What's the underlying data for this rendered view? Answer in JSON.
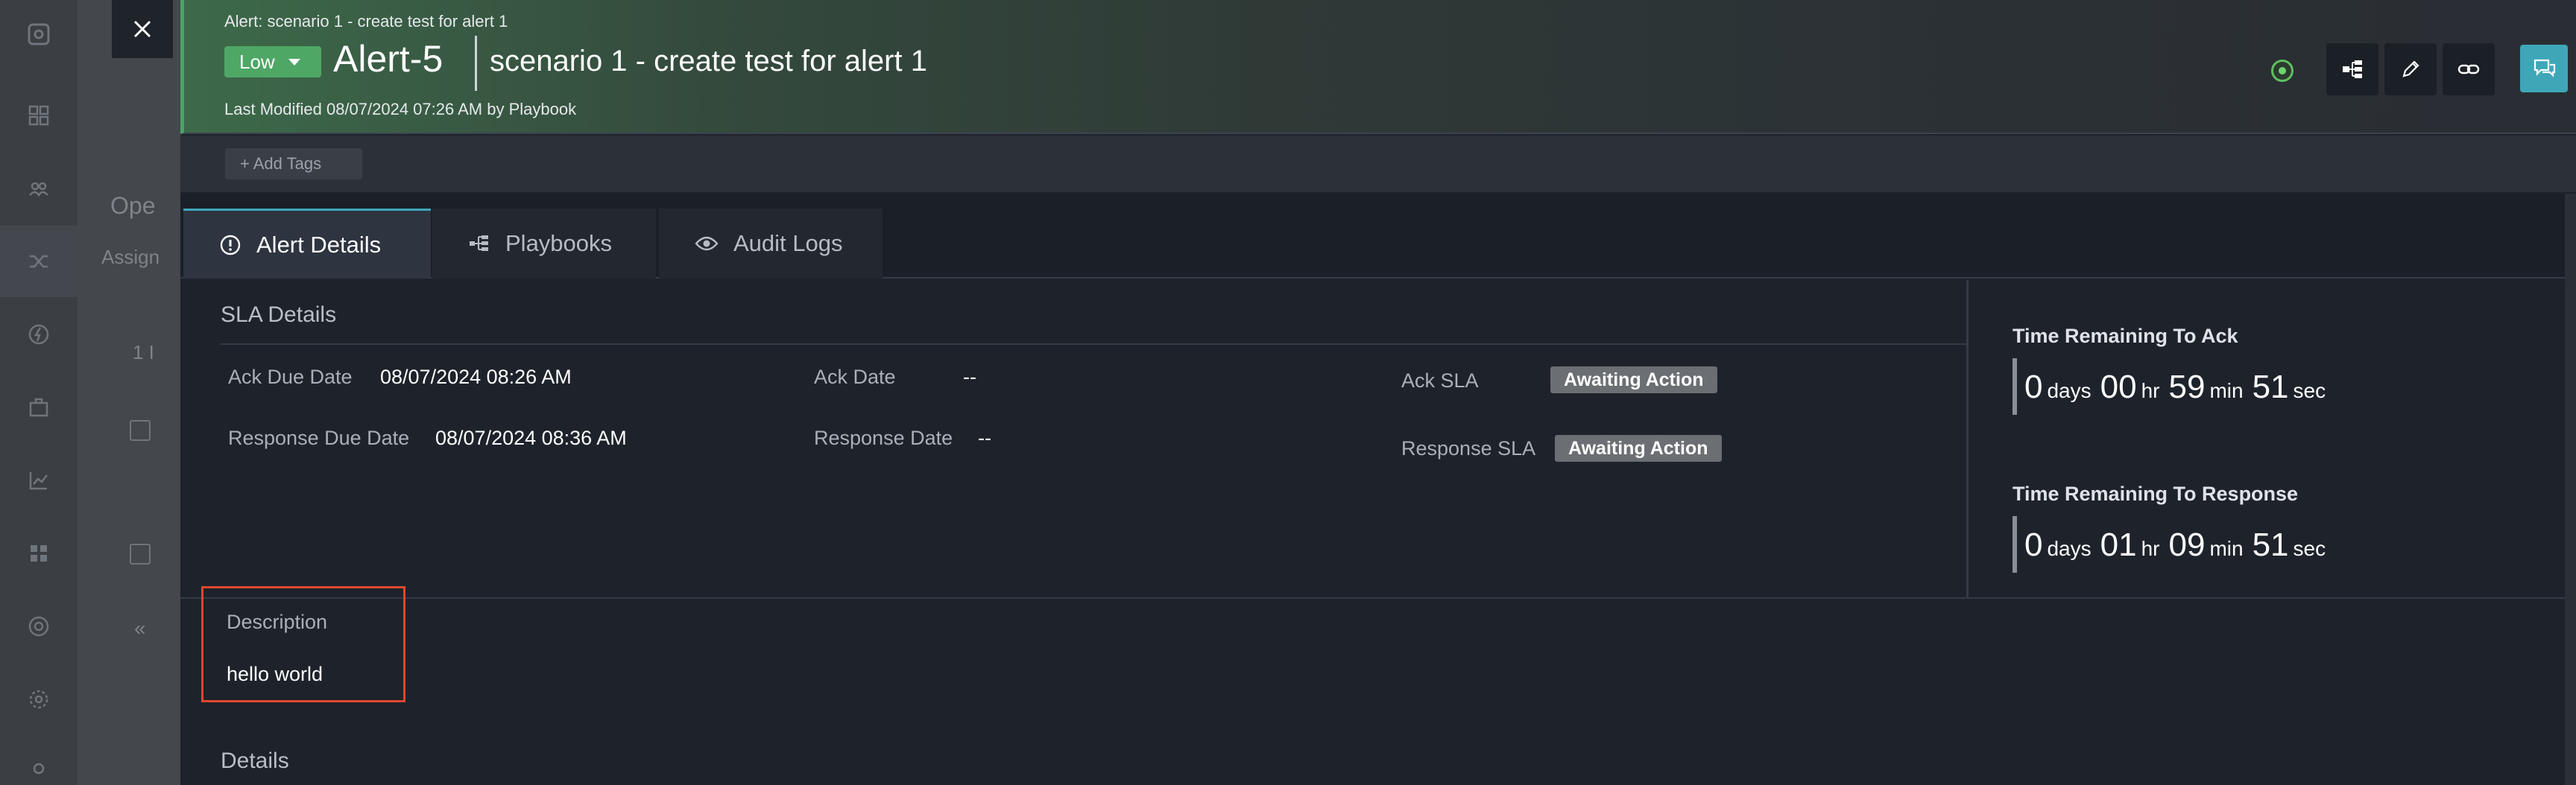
{
  "background": {
    "partial_heading": "Ope",
    "partial_subheading": "Assign",
    "partial_count": "1 I",
    "collapse_glyph": "«"
  },
  "header": {
    "breadcrumb": "Alert: scenario 1 - create test for alert 1",
    "severity": "Low",
    "alert_id": "Alert-5",
    "alert_title": "scenario 1 - create test for alert 1",
    "last_modified": "Last Modified 08/07/2024 07:26 AM by Playbook",
    "status_color": "#5fbf5f",
    "accent_color": "#3fa6b8"
  },
  "tags": {
    "add_label": "+ Add Tags"
  },
  "tabs": [
    {
      "label": "Alert Details",
      "icon": "info-circle-icon",
      "active": true
    },
    {
      "label": "Playbooks",
      "icon": "playbook-icon",
      "active": false
    },
    {
      "label": "Audit Logs",
      "icon": "eye-icon",
      "active": false
    }
  ],
  "sla": {
    "heading": "SLA Details",
    "ack_due_label": "Ack Due Date",
    "ack_due_value": "08/07/2024 08:26 AM",
    "response_due_label": "Response Due Date",
    "response_due_value": "08/07/2024 08:36 AM",
    "ack_date_label": "Ack Date",
    "ack_date_value": "--",
    "response_date_label": "Response Date",
    "response_date_value": "--",
    "ack_sla_label": "Ack SLA",
    "ack_sla_value": "Awaiting Action",
    "response_sla_label": "Response SLA",
    "response_sla_value": "Awaiting Action"
  },
  "timers": {
    "ack": {
      "title": "Time Remaining To Ack",
      "days": "0",
      "hr": "00",
      "min": "59",
      "sec": "51"
    },
    "response": {
      "title": "Time Remaining To Response",
      "days": "0",
      "hr": "01",
      "min": "09",
      "sec": "51"
    },
    "units": {
      "days": "days",
      "hr": "hr",
      "min": "min",
      "sec": "sec"
    }
  },
  "description": {
    "label": "Description",
    "value": "hello world"
  },
  "details": {
    "heading": "Details"
  }
}
